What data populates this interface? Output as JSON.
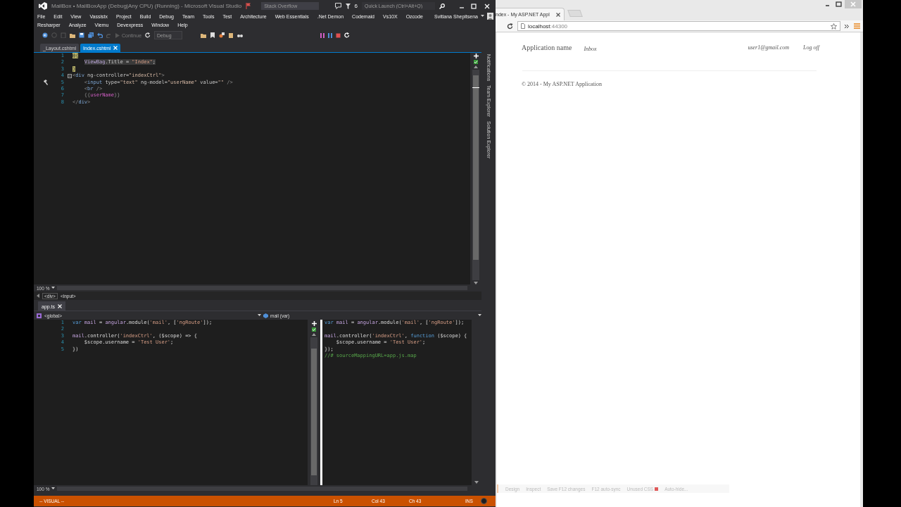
{
  "ide": {
    "title": "MailBox • MailBoxApp (Debug|Any CPU) (Running) - Microsoft Visual Studio",
    "search": {
      "placeholder": "Stack Overflow"
    },
    "notification_count": "6",
    "quick_launch": {
      "placeholder": "Quick Launch (Ctrl+Alt+Q)"
    },
    "user": "Svitlana Shepitsena",
    "menu_rows": [
      [
        "File",
        "Edit",
        "View",
        "Vassistx",
        "Project",
        "Build",
        "Debug",
        "Team",
        "Tools",
        "Test",
        "Architecture",
        "Web Essentials",
        ".Net Demon",
        "Codemaid",
        "Vs10X",
        "Ozcode"
      ],
      [
        "Resharper",
        "Analyze",
        "Viemu",
        "Devexpress",
        "Window",
        "Help"
      ]
    ],
    "toolbar": {
      "continue": {
        "label": "Continue",
        "disabled": true
      },
      "configuration": {
        "value": "Debug",
        "disabled": true
      }
    },
    "doc_tabs": [
      {
        "label": "_Layout.cshtml",
        "selected": false
      },
      {
        "label": "Index.cshtml",
        "selected": true
      }
    ],
    "editor": {
      "lines": [
        {
          "n": "1",
          "fold": false,
          "glyph": false,
          "tokens": [
            {
              "kind": "razor",
              "text": "@{"
            }
          ]
        },
        {
          "n": "2",
          "fold": false,
          "glyph": false,
          "tokens": [
            {
              "kind": "cstype",
              "text": "    ViewBag"
            },
            {
              "kind": "cs",
              "text": ".Title = "
            },
            {
              "kind": "csstr",
              "text": "\"Index\""
            },
            {
              "kind": "cs",
              "text": ";"
            }
          ]
        },
        {
          "n": "3",
          "fold": false,
          "glyph": false,
          "tokens": [
            {
              "kind": "razor",
              "text": "}"
            }
          ]
        },
        {
          "n": "4",
          "fold": true,
          "glyph": false,
          "tokens": [
            {
              "kind": "punct",
              "text": "<"
            },
            {
              "kind": "tag",
              "text": "div"
            },
            {
              "kind": "attr",
              "text": " ng-controller="
            },
            {
              "kind": "val",
              "text": "\"indexCtrl\""
            },
            {
              "kind": "punct",
              "text": ">"
            }
          ]
        },
        {
          "n": "5",
          "fold": false,
          "glyph": true,
          "tokens": [
            {
              "kind": "punct",
              "text": "    <"
            },
            {
              "kind": "tag",
              "text": "input"
            },
            {
              "kind": "attr",
              "text": " type="
            },
            {
              "kind": "val",
              "text": "\"text\""
            },
            {
              "kind": "attr",
              "text": " ng-model="
            },
            {
              "kind": "val",
              "text": "\"userName\""
            },
            {
              "kind": "attr",
              "text": " value="
            },
            {
              "kind": "val",
              "text": "\"\""
            },
            {
              "kind": "punct",
              "text": " />"
            }
          ]
        },
        {
          "n": "6",
          "fold": false,
          "glyph": false,
          "tokens": [
            {
              "kind": "punct",
              "text": "    <"
            },
            {
              "kind": "tag",
              "text": "br"
            },
            {
              "kind": "punct",
              "text": " />"
            }
          ]
        },
        {
          "n": "7",
          "fold": false,
          "glyph": false,
          "tokens": [
            {
              "kind": "punct",
              "text": "    {{"
            },
            {
              "kind": "ng",
              "text": "userName"
            },
            {
              "kind": "punct",
              "text": "}}"
            }
          ]
        },
        {
          "n": "8",
          "fold": false,
          "glyph": false,
          "tokens": [
            {
              "kind": "punct",
              "text": "</"
            },
            {
              "kind": "tag",
              "text": "div"
            },
            {
              "kind": "punct",
              "text": ">"
            }
          ]
        }
      ]
    },
    "side_tabs": [
      "Notifications",
      "Team Explorer",
      "Solution Explorer"
    ],
    "zoom": "100 %",
    "breadcrumb": [
      "<div>",
      "<input>"
    ],
    "bottom_tabs": [
      {
        "label": "app.ts",
        "selected": true
      }
    ],
    "nav": {
      "scope": "<global>",
      "member": "mail (var)"
    },
    "ts_editor": {
      "lines": [
        {
          "n": "1",
          "tokens": [
            {
              "kind": "kw",
              "text": "var "
            },
            {
              "kind": "id",
              "text": "mail"
            },
            {
              "kind": "plain",
              "text": " = "
            },
            {
              "kind": "id",
              "text": "angular"
            },
            {
              "kind": "plain",
              "text": ".module("
            },
            {
              "kind": "str",
              "text": "'mail'"
            },
            {
              "kind": "plain",
              "text": ", ["
            },
            {
              "kind": "str",
              "text": "'ngRoute'"
            },
            {
              "kind": "plain",
              "text": "]);"
            }
          ]
        },
        {
          "n": "2"
        },
        {
          "n": "3",
          "tokens": [
            {
              "kind": "id",
              "text": "mail"
            },
            {
              "kind": "plain",
              "text": ".controller("
            },
            {
              "kind": "str",
              "text": "'indexCtrl'"
            },
            {
              "kind": "plain",
              "text": ", ($scope) => {"
            }
          ]
        },
        {
          "n": "4",
          "tokens": [
            {
              "kind": "plain",
              "text": "    $scope.username = "
            },
            {
              "kind": "str",
              "text": "'Test User'"
            },
            {
              "kind": "plain",
              "text": ";"
            }
          ]
        },
        {
          "n": "5",
          "tokens": [
            {
              "kind": "plain",
              "text": "})"
            }
          ]
        }
      ]
    },
    "js_preview": {
      "lines": [
        {
          "kind": "code",
          "tokens": [
            {
              "kind": "kw",
              "text": "var "
            },
            {
              "kind": "id",
              "text": "mail"
            },
            {
              "kind": "plain",
              "text": " = "
            },
            {
              "kind": "id",
              "text": "angular"
            },
            {
              "kind": "plain",
              "text": ".module("
            },
            {
              "kind": "str",
              "text": "'mail'"
            },
            {
              "kind": "plain",
              "text": ", ["
            },
            {
              "kind": "str",
              "text": "'ngRoute'"
            },
            {
              "kind": "plain",
              "text": "]);"
            }
          ]
        },
        {
          "kind": "blank"
        },
        {
          "kind": "code",
          "tokens": [
            {
              "kind": "id",
              "text": "mail"
            },
            {
              "kind": "plain",
              "text": ".controller("
            },
            {
              "kind": "str",
              "text": "'indexCtrl'"
            },
            {
              "kind": "plain",
              "text": ", "
            },
            {
              "kind": "kw",
              "text": "function"
            },
            {
              "kind": "plain",
              "text": " ($scope) {"
            }
          ]
        },
        {
          "kind": "code",
          "tokens": [
            {
              "kind": "plain",
              "text": "    $scope.username = "
            },
            {
              "kind": "str",
              "text": "'Test User'"
            },
            {
              "kind": "plain",
              "text": ";"
            }
          ]
        },
        {
          "kind": "code",
          "tokens": [
            {
              "kind": "plain",
              "text": "});"
            }
          ]
        },
        {
          "kind": "code",
          "tokens": [
            {
              "kind": "cmt",
              "text": "//# sourceMappingURL=app.js.map"
            }
          ]
        }
      ]
    },
    "bottom_zoom": "100 %",
    "status": {
      "mode": "-- VISUAL --",
      "ln": "Ln 5",
      "col": "Col 43",
      "ch": "Ch 43",
      "ins": "INS"
    }
  },
  "browser": {
    "tab": {
      "title": "ndex - My ASP.NET Appl",
      "selected": true
    },
    "address": {
      "host": "localhost",
      "port": ":44300"
    },
    "page": {
      "brand": "Application name",
      "nav": [
        "Inbox"
      ],
      "user": "user1@gmail.com",
      "logoff": "Log off",
      "footer": "© 2014 - My ASP.NET Application"
    },
    "devtools": [
      {
        "label": "Design",
        "kind": "plain"
      },
      {
        "label": "Inspect",
        "kind": "plain"
      },
      {
        "label": "Save F12 changes",
        "kind": "plain"
      },
      {
        "label": "F12 auto-sync",
        "kind": "plain"
      },
      {
        "label": "Unused CSS",
        "kind": "flag"
      },
      {
        "label": "Auto-hide...",
        "kind": "plain"
      }
    ]
  }
}
